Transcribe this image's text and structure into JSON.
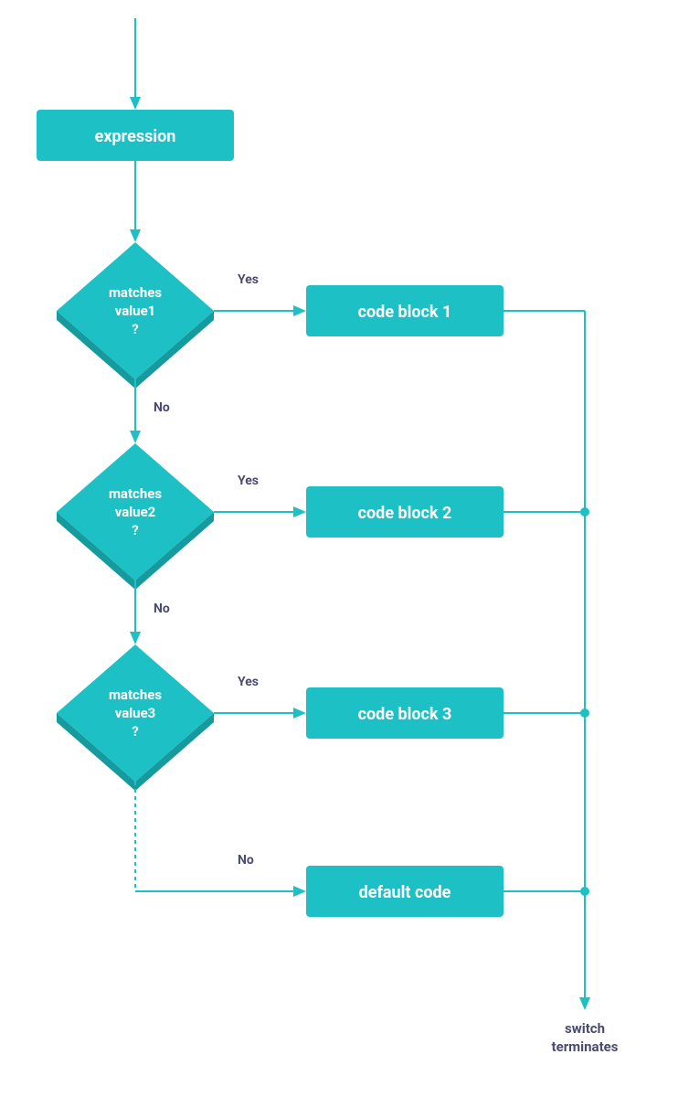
{
  "nodes": {
    "expression": "expression",
    "d1_line1": "matches",
    "d1_line2": "value1",
    "d1_line3": "?",
    "d2_line1": "matches",
    "d2_line2": "value2",
    "d2_line3": "?",
    "d3_line1": "matches",
    "d3_line2": "value3",
    "d3_line3": "?",
    "block1": "code block 1",
    "block2": "code block 2",
    "block3": "code block 3",
    "default": "default code"
  },
  "labels": {
    "yes": "Yes",
    "no": "No"
  },
  "terminal": {
    "line1": "switch",
    "line2": "terminates"
  }
}
